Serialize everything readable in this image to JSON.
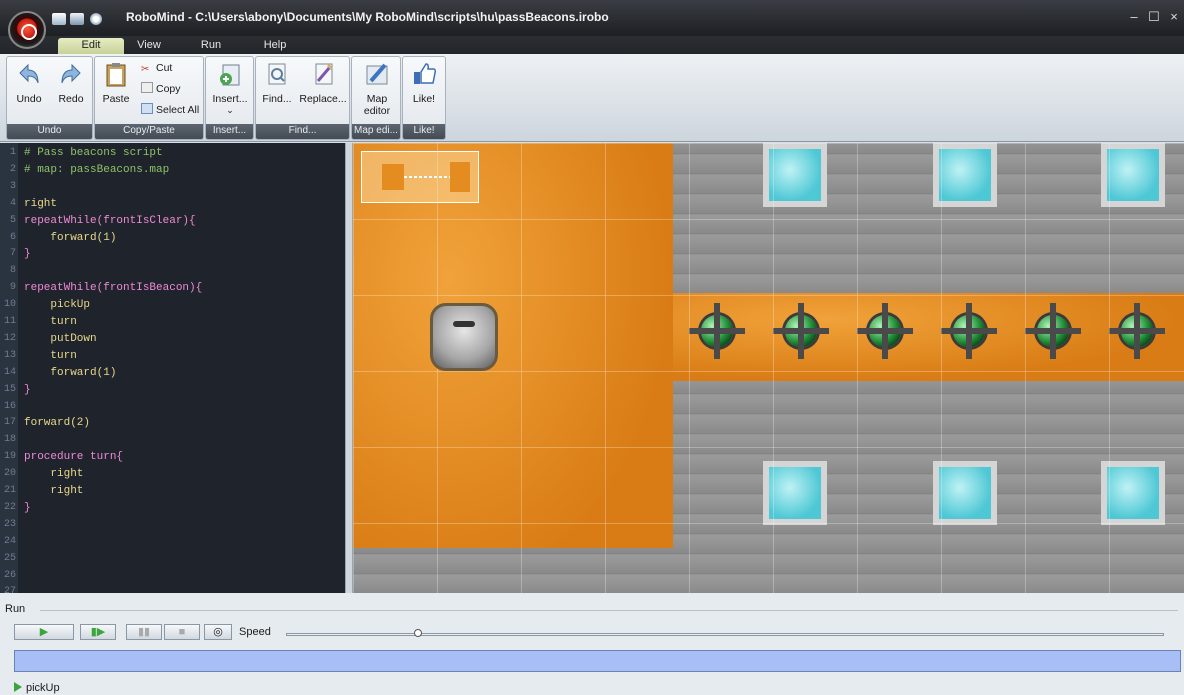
{
  "window": {
    "title": "RoboMind - C:\\Users\\abony\\Documents\\My RoboMind\\scripts\\hu\\passBeacons.irobo",
    "minimize": "–",
    "maximize": "☐",
    "close": "×"
  },
  "menu_tabs": [
    "Edit",
    "View",
    "Run",
    "Help"
  ],
  "ribbon": {
    "undo": "Undo",
    "redo": "Redo",
    "undo_group": "Undo",
    "paste": "Paste",
    "cut": "Cut",
    "copy": "Copy",
    "select_all": "Select All",
    "copypaste_group": "Copy/Paste",
    "insert": "Insert...",
    "insert_group": "Insert...",
    "find": "Find...",
    "replace": "Replace...",
    "find_group": "Find...",
    "map_editor_1": "Map",
    "map_editor_2": "editor",
    "map_group": "Map edi...",
    "like": "Like!",
    "like_group": "Like!"
  },
  "code": [
    {
      "n": "1",
      "t": "# Pass beacons script",
      "c": "com"
    },
    {
      "n": "2",
      "t": "# map: passBeacons.map",
      "c": "com"
    },
    {
      "n": "3",
      "t": "",
      "c": "pl"
    },
    {
      "n": "4",
      "t": "right",
      "c": "fn"
    },
    {
      "n": "5",
      "t": "repeatWhile(frontIsClear){",
      "c": "kw"
    },
    {
      "n": "6",
      "t": "    forward(1)",
      "c": "fn"
    },
    {
      "n": "7",
      "t": "}",
      "c": "kw"
    },
    {
      "n": "8",
      "t": "",
      "c": "pl"
    },
    {
      "n": "9",
      "t": "repeatWhile(frontIsBeacon){",
      "c": "kw"
    },
    {
      "n": "10",
      "t": "    pickUp",
      "c": "fn"
    },
    {
      "n": "11",
      "t": "    turn",
      "c": "fn"
    },
    {
      "n": "12",
      "t": "    putDown",
      "c": "fn"
    },
    {
      "n": "13",
      "t": "    turn",
      "c": "fn"
    },
    {
      "n": "14",
      "t": "    forward(1)",
      "c": "fn"
    },
    {
      "n": "15",
      "t": "}",
      "c": "kw"
    },
    {
      "n": "16",
      "t": "",
      "c": "pl"
    },
    {
      "n": "17",
      "t": "forward(2)",
      "c": "fn"
    },
    {
      "n": "18",
      "t": "",
      "c": "pl"
    },
    {
      "n": "19",
      "t": "procedure turn{",
      "c": "kw"
    },
    {
      "n": "20",
      "t": "    right",
      "c": "fn"
    },
    {
      "n": "21",
      "t": "    right",
      "c": "fn"
    },
    {
      "n": "22",
      "t": "}",
      "c": "kw"
    },
    {
      "n": "23",
      "t": "",
      "c": "pl"
    },
    {
      "n": "24",
      "t": "",
      "c": "pl"
    },
    {
      "n": "25",
      "t": "",
      "c": "pl"
    },
    {
      "n": "26",
      "t": "",
      "c": "pl"
    },
    {
      "n": "27",
      "t": "",
      "c": "pl"
    }
  ],
  "run_panel": {
    "title": "Run",
    "speed_label": "Speed",
    "speed": 0.15,
    "play": "▶",
    "step": "▮▶",
    "pause": "▮▮",
    "stop": "■",
    "record": "◎"
  },
  "status": {
    "text": "pickUp"
  },
  "colors": {
    "sand": "#e48c1f",
    "progress": "#a7bef7",
    "editor_bg": "#1f232b"
  }
}
